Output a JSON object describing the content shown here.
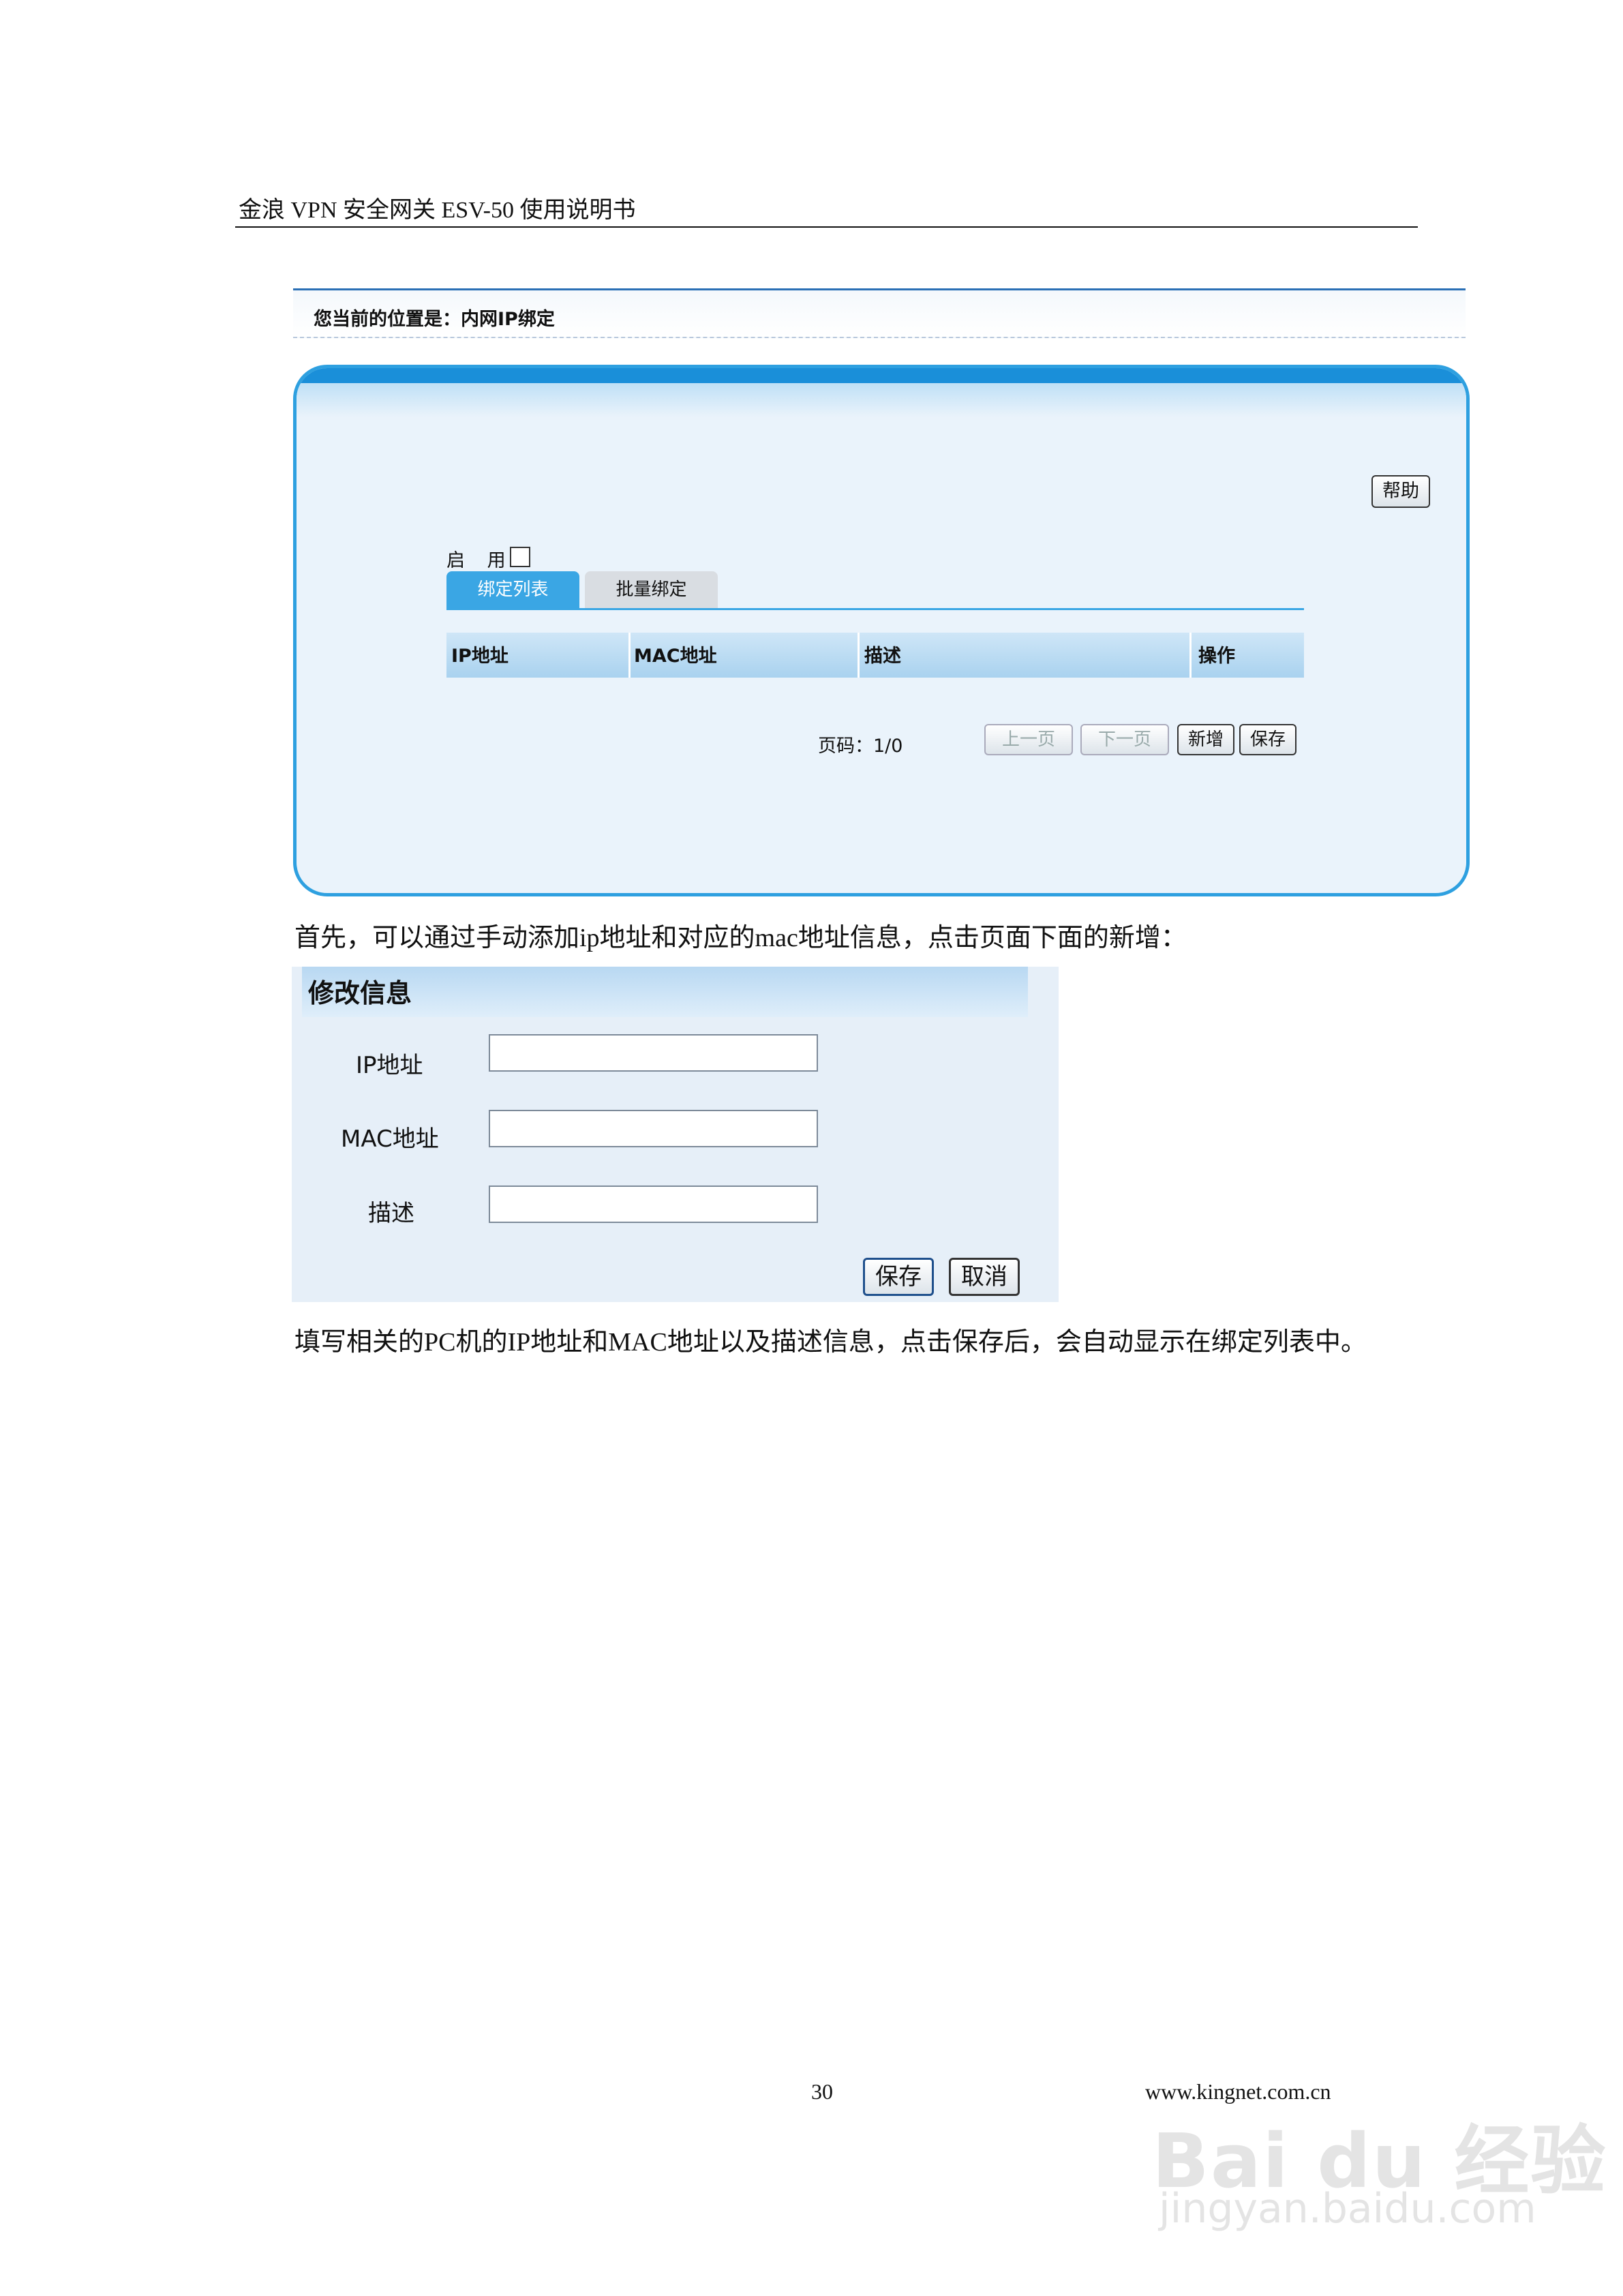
{
  "header": {
    "title": "金浪 VPN 安全网关 ESV-50 使用说明书"
  },
  "location": {
    "text": "您当前的位置是：内网IP绑定"
  },
  "panel": {
    "help_label": "帮助",
    "enable_label": "启 用",
    "enable_checked": false,
    "tabs": [
      {
        "label": "绑定列表",
        "active": true
      },
      {
        "label": "批量绑定",
        "active": false
      }
    ],
    "columns": [
      "IP地址",
      "MAC地址",
      "描述",
      "操作"
    ],
    "page_label": "页码：1/0",
    "prev_label": "上一页",
    "next_label": "下一页",
    "add_label": "新增",
    "save_label": "保存"
  },
  "para1": "首先，可以通过手动添加ip地址和对应的mac地址信息，点击页面下面的新增：",
  "dialog": {
    "title": "修改信息",
    "fields": [
      {
        "label": "IP地址",
        "value": ""
      },
      {
        "label": "MAC地址",
        "value": ""
      },
      {
        "label": "描述",
        "value": ""
      }
    ],
    "save_label": "保存",
    "cancel_label": "取消"
  },
  "para2": "填写相关的PC机的IP地址和MAC地址以及描述信息，点击保存后，会自动显示在绑定列表中。",
  "footer": {
    "page_number": "30",
    "site": "www.kingnet.com.cn"
  },
  "watermark": {
    "line1": "Bai du 经验",
    "line2": "jingyan.baidu.com"
  },
  "colors": {
    "accent": "#2ea0e0",
    "tab_active": "#3aa6e4",
    "panel_bg": "#eaf3fb"
  }
}
